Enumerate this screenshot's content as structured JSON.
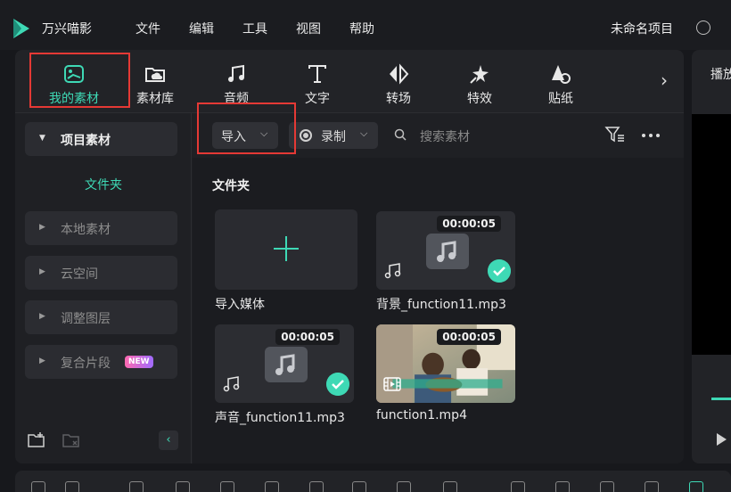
{
  "app": {
    "name": "万兴喵影",
    "project_name": "未命名项目"
  },
  "menu": [
    "文件",
    "编辑",
    "工具",
    "视图",
    "帮助"
  ],
  "toolbar": {
    "tabs": [
      {
        "label": "我的素材",
        "icon": "my-media-icon",
        "active": true
      },
      {
        "label": "素材库",
        "icon": "stock-media-icon"
      },
      {
        "label": "音频",
        "icon": "music-note-icon"
      },
      {
        "label": "文字",
        "icon": "text-icon"
      },
      {
        "label": "转场",
        "icon": "transition-icon"
      },
      {
        "label": "特效",
        "icon": "effects-icon"
      },
      {
        "label": "贴纸",
        "icon": "sticker-icon"
      }
    ],
    "more": "›"
  },
  "sidebar": {
    "project_media": "项目素材",
    "folder": "文件夹",
    "items": [
      {
        "label": "本地素材"
      },
      {
        "label": "云空间"
      },
      {
        "label": "调整图层"
      },
      {
        "label": "复合片段",
        "badge": "NEW"
      }
    ]
  },
  "content": {
    "import_label": "导入",
    "record_label": "录制",
    "search_placeholder": "搜索素材",
    "section_title": "文件夹",
    "items": [
      {
        "label": "导入媒体",
        "type": "import"
      },
      {
        "label": "背景_function11.mp3",
        "type": "audio",
        "duration": "00:00:05"
      },
      {
        "label": "声音_function11.mp3",
        "type": "audio",
        "duration": "00:00:05"
      },
      {
        "label": "function1.mp4",
        "type": "video",
        "duration": "00:00:05"
      }
    ]
  },
  "right_panel": {
    "tab": "播放"
  },
  "colors": {
    "accent": "#3ed9b5",
    "highlight": "#e53935"
  }
}
